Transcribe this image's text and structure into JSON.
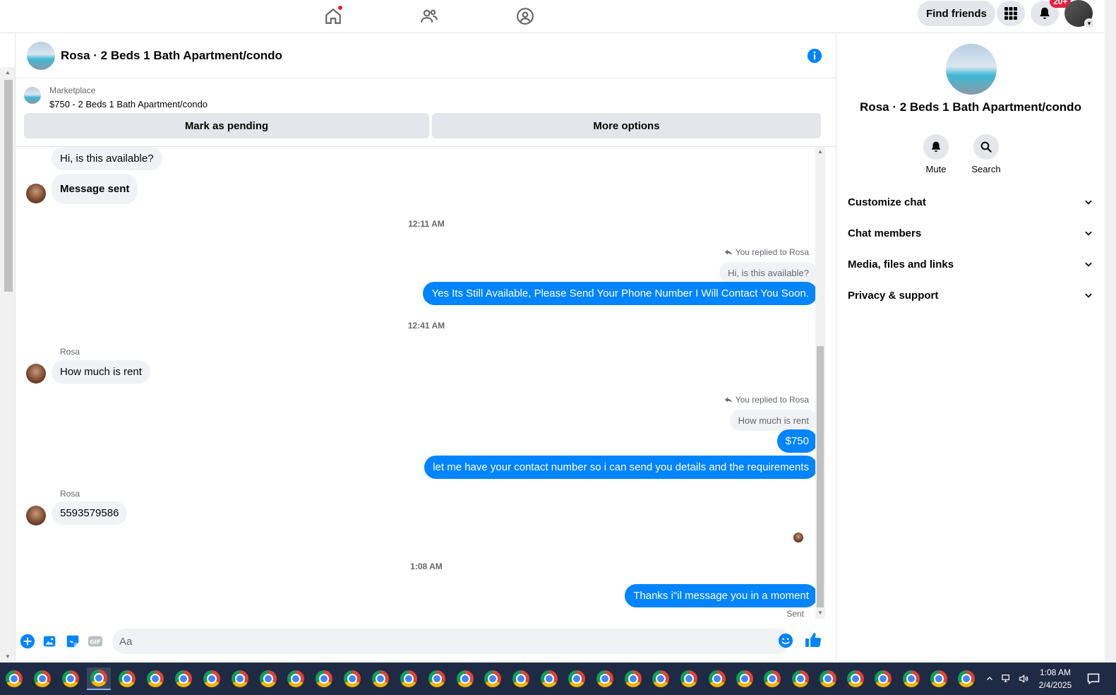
{
  "topnav": {
    "find_friends": "Find friends",
    "badge": "20+"
  },
  "chat": {
    "title": "Rosa · 2 Beds 1 Bath Apartment/condo",
    "marketplace_label": "Marketplace",
    "listing_title": "$750 - 2 Beds 1 Bath Apartment/condo",
    "mark_pending": "Mark as pending",
    "more_options": "More options"
  },
  "messages": {
    "m1": "Hi, is this available?",
    "m2": "Message sent",
    "t1": "12:11 AM",
    "reply1_label": "You replied to Rosa",
    "reply1_quote": "Hi, is this available?",
    "m3": "Yes Its Still Available, Please Send Your Phone Number I Will Contact You Soon.",
    "t2": "12:41 AM",
    "sender1": "Rosa",
    "m4": "How much is rent",
    "reply2_label": "You replied to Rosa",
    "reply2_quote": "How much is rent",
    "m5": "$750",
    "m6": "let me have your contact number so i can send you details and the requirements",
    "sender2": "Rosa",
    "m7": "5593579586",
    "t3": "1:08 AM",
    "m8": "Thanks i\"il message you in a moment",
    "status": "Sent"
  },
  "composer": {
    "placeholder": "Aa"
  },
  "panel": {
    "title": "Rosa · 2 Beds 1 Bath Apartment/condo",
    "mute": "Mute",
    "search": "Search",
    "sections": [
      "Customize chat",
      "Chat members",
      "Media, files and links",
      "Privacy & support"
    ]
  },
  "taskbar": {
    "time": "1:08 AM",
    "date": "2/4/2025"
  },
  "colors": {
    "messenger_blue": "#0084ff",
    "incoming_bubble": "#f0f2f5",
    "notification_red": "#e41e3f"
  },
  "icons": [
    "home-icon",
    "friends-icon",
    "groups-icon",
    "apps-grid-icon",
    "bell-icon",
    "info-icon",
    "plus-icon",
    "image-icon",
    "sticker-icon",
    "gif-icon",
    "emoji-icon",
    "like-icon",
    "mute-bell-icon",
    "search-icon",
    "chevron-down-icon",
    "chrome-icon"
  ]
}
